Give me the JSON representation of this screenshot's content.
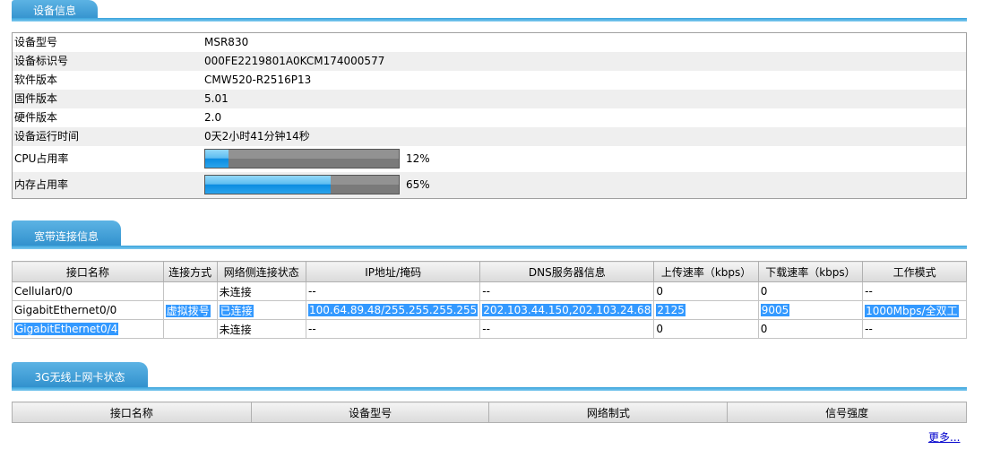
{
  "device_info": {
    "tab": "设备信息",
    "rows": [
      {
        "label": "设备型号",
        "value": "MSR830"
      },
      {
        "label": "设备标识号",
        "value": "000FE2219801A0KCM174000577"
      },
      {
        "label": "软件版本",
        "value": "CMW520-R2516P13"
      },
      {
        "label": "固件版本",
        "value": "5.01"
      },
      {
        "label": "硬件版本",
        "value": "2.0"
      },
      {
        "label": "设备运行时间",
        "value": "0天2小时41分钟14秒"
      }
    ],
    "cpu": {
      "label": "CPU占用率",
      "percent_text": "12%",
      "percent": 12
    },
    "memory": {
      "label": "内存占用率",
      "percent_text": "65%",
      "percent": 65
    }
  },
  "broadband": {
    "tab": "宽带连接信息",
    "headers": [
      "接口名称",
      "连接方式",
      "网络侧连接状态",
      "IP地址/掩码",
      "DNS服务器信息",
      "上传速率（kbps）",
      "下载速率（kbps）",
      "工作模式"
    ],
    "rows": [
      [
        "Cellular0/0",
        "",
        "未连接",
        "--",
        "--",
        "0",
        "0",
        "--"
      ],
      [
        "GigabitEthernet0/0",
        "虚拟拨号",
        "已连接",
        "100.64.89.48/255.255.255.255",
        "202.103.44.150,202.103.24.68",
        "2125",
        "9005",
        "1000Mbps/全双工"
      ],
      [
        "GigabitEthernet0/4",
        "",
        "未连接",
        "--",
        "--",
        "0",
        "0",
        "--"
      ]
    ]
  },
  "wireless3g": {
    "tab": "3G无线上网卡状态",
    "headers": [
      "接口名称",
      "设备型号",
      "网络制式",
      "信号强度"
    ]
  },
  "more_link": "更多..."
}
